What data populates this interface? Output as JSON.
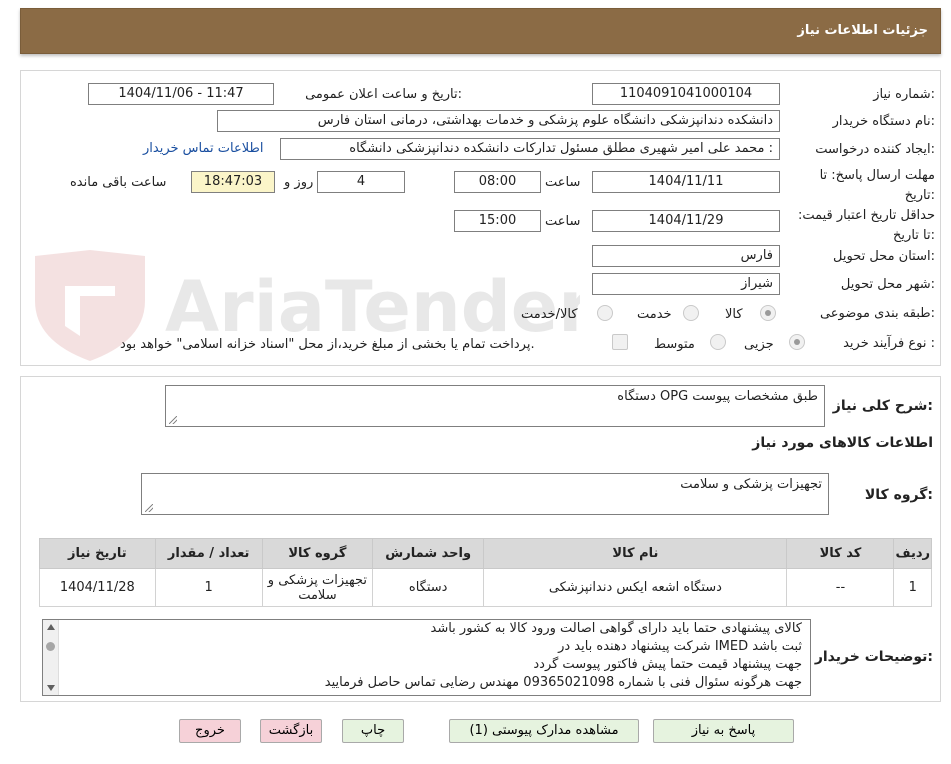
{
  "header": {
    "title": "جزئیات اطلاعات نیاز"
  },
  "labels": {
    "need_number": "شماره نیاز:",
    "announce_datetime": "تاریخ و ساعت اعلان عمومی:",
    "buyer_org": "نام دستگاه خریدار:",
    "requester": "ایجاد کننده درخواست:",
    "reply_deadline": "مهلت ارسال پاسخ: تا تاریخ:",
    "time": "ساعت",
    "day_and": "روز و",
    "hours_remaining": "ساعت باقی مانده",
    "price_validity": "حداقل تاریخ اعتبار قیمت: تا تاریخ:",
    "delivery_province": "استان محل تحویل:",
    "delivery_city": "شهر محل تحویل:",
    "category": "طبقه بندی موضوعی:",
    "purchase_process": "نوع فرآیند خرید :",
    "general_description": "شرح کلی نیاز:",
    "goods_info": "اطلاعات کالاهای مورد نیاز",
    "goods_group": "گروه کالا:",
    "buyer_notes": "توضیحات خریدار:"
  },
  "values": {
    "need_number": "1104091041000104",
    "announce_datetime": "1404/11/06 - 11:47",
    "buyer_org": "دانشکده دندانپزشکی دانشگاه علوم پزشکی و خدمات بهداشتی، درمانی استان فارس",
    "requester": "محمد علی امیر شهیری مطلق مسئول تدارکات دانشکده دندانپزشکی دانشگاه :",
    "contact_link": "اطلاعات تماس خریدار",
    "reply_date": "1404/11/11",
    "reply_time": "08:00",
    "days_remaining": "4",
    "time_remaining": "18:47:03",
    "validity_date": "1404/11/29",
    "validity_time": "15:00",
    "province": "فارس",
    "city": "شیراز",
    "general_description": "دستگاه OPG طبق مشخصات پیوست",
    "goods_group": "تجهیزات پزشکی و سلامت"
  },
  "category_options": [
    "کالا",
    "خدمت",
    "کالا/خدمت"
  ],
  "process_options": [
    "جزیی",
    "متوسط"
  ],
  "payment_note": "پرداخت تمام یا بخشی از مبلغ خرید،از محل \"اسناد خزانه اسلامی\" خواهد بود.",
  "table": {
    "headers": [
      "ردیف",
      "کد کالا",
      "نام کالا",
      "واحد شمارش",
      "گروه کالا",
      "تعداد / مقدار",
      "تاریخ نیاز"
    ],
    "rows": [
      [
        "1",
        "--",
        "دستگاه اشعه ایکس دندانپزشکی",
        "دستگاه",
        "تجهیزات پزشکی و سلامت",
        "1",
        "1404/11/28"
      ]
    ]
  },
  "notes": [
    "کالای پیشنهادی حتما باید دارای گواهی اصالت ورود کالا به کشور باشد",
    "شرکت پیشنهاد دهنده باید در IMED ثبت باشد",
    "جهت پیشنهاد قیمت حتما پیش فاکتور پیوست گردد",
    "جهت هرگونه سئوال فنی با شماره 09365021098 مهندس رضایی تماس حاصل فرمایید"
  ],
  "buttons": {
    "reply": "پاسخ به نیاز",
    "view_docs": "مشاهده مدارک پیوستی (1)",
    "print": "چاپ",
    "back": "بازگشت",
    "exit": "خروج"
  },
  "watermark": {
    "text": "AriaTender.neT"
  },
  "colors": {
    "header_bg": "#8b6b45",
    "button_green": "#e6f3df",
    "button_red": "#f6d1d8",
    "highlight_yellow": "#fbf5c9"
  }
}
